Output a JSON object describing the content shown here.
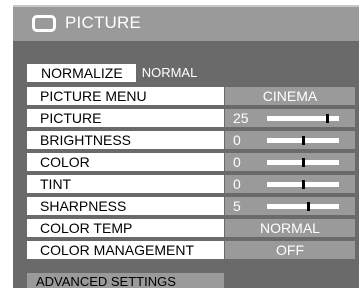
{
  "header": {
    "title": "PICTURE",
    "icon": "picture-monitor-icon"
  },
  "normalize": {
    "button_label": "NORMALIZE",
    "current_value": "NORMAL"
  },
  "rows": {
    "picture_menu": {
      "label": "PICTURE MENU",
      "value": "CINEMA"
    },
    "picture": {
      "label": "PICTURE",
      "value": "25",
      "level": 0.86
    },
    "brightness": {
      "label": "BRIGHTNESS",
      "value": "0",
      "level": 0.5
    },
    "color": {
      "label": "COLOR",
      "value": "0",
      "level": 0.5
    },
    "tint": {
      "label": "TINT",
      "value": "0",
      "level": 0.5
    },
    "sharpness": {
      "label": "SHARPNESS",
      "value": "5",
      "level": 0.58
    },
    "color_temp": {
      "label": "COLOR TEMP",
      "value": "NORMAL"
    },
    "color_management": {
      "label": "COLOR MANAGEMENT",
      "value": "OFF"
    }
  },
  "advanced": {
    "label": "ADVANCED SETTINGS"
  },
  "colors": {
    "panel": "#6a6a6a",
    "highlight": "#9a9a9a",
    "text_on_panel": "#ffffff"
  }
}
